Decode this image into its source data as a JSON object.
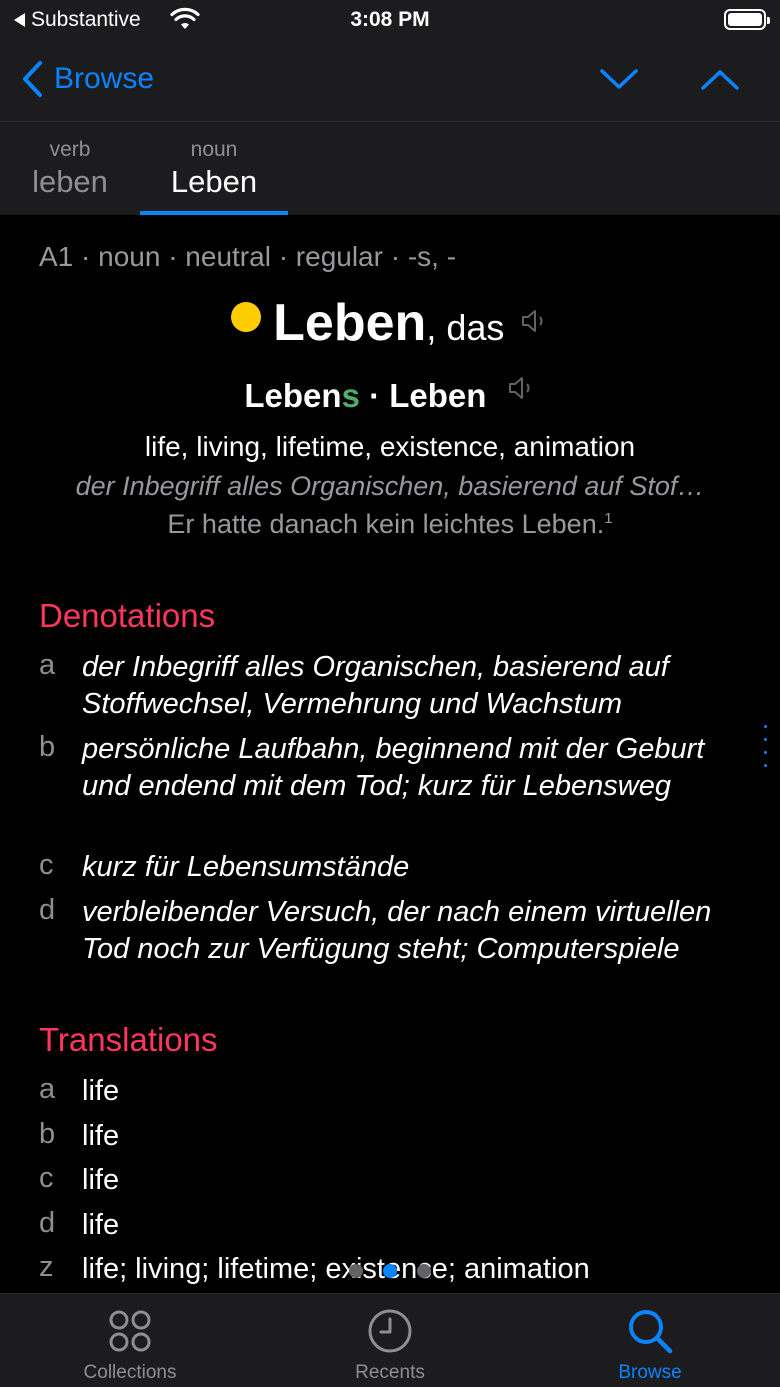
{
  "status_bar": {
    "back_app": "Substantive",
    "time": "3:08 PM"
  },
  "nav": {
    "back_label": "Browse"
  },
  "tabs": [
    {
      "pos": "verb",
      "word": "leben"
    },
    {
      "pos": "noun",
      "word": "Leben"
    }
  ],
  "entry": {
    "meta": "A1 · noun · neutral · regular · -s, -",
    "lemma": "Leben",
    "article": ", das",
    "gender_color": "#ffcc00",
    "forms": {
      "genitive_stem": "Leben",
      "genitive_ending": "s",
      "separator": " · ",
      "plural": "Leben"
    },
    "summary": "life, living, lifetime, existence, animation",
    "definition_preview": "der Inbegriff alles Organischen, basierend auf Stof…",
    "example": "Er hatte danach kein leichtes Leben.",
    "example_ref": "1"
  },
  "denotations": {
    "title": "Denotations",
    "items": [
      {
        "letter": "a",
        "text": "der Inbegriff alles Organischen, basierend auf Stoffwechsel, Vermehrung und Wachstum"
      },
      {
        "letter": "b",
        "text": "persönliche Laufbahn, beginnend mit der Geburt und endend mit dem Tod; kurz für Lebensweg"
      },
      {
        "letter": "c",
        "text": "kurz für Lebensumstände"
      },
      {
        "letter": "d",
        "text": "verbleibender Versuch, der nach einem virtuellen Tod noch zur Verfügung steht; Computerspiele"
      }
    ]
  },
  "translations": {
    "title": "Translations",
    "items": [
      {
        "letter": "a",
        "text": "life"
      },
      {
        "letter": "b",
        "text": "life"
      },
      {
        "letter": "c",
        "text": "life"
      },
      {
        "letter": "d",
        "text": "life"
      },
      {
        "letter": "z",
        "text": "life; living; lifetime; existence; animation"
      }
    ]
  },
  "page_indicator": {
    "count": 3,
    "current": 2
  },
  "tab_bar": {
    "items": [
      {
        "label": "Collections",
        "icon": "collections-icon"
      },
      {
        "label": "Recents",
        "icon": "clock-icon"
      },
      {
        "label": "Browse",
        "icon": "search-icon"
      }
    ],
    "active": "Browse"
  },
  "colors": {
    "accent": "#0a84ff",
    "section_title": "#ff375f",
    "ending_highlight": "#4cae6a"
  }
}
